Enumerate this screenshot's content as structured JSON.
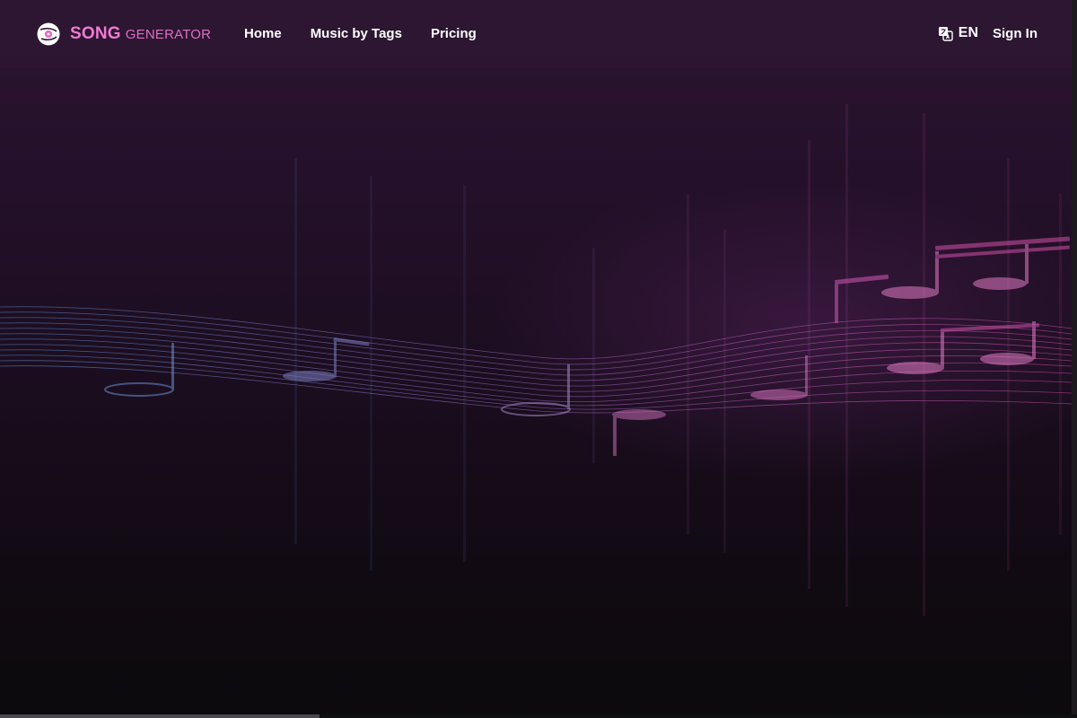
{
  "brand": {
    "name_primary": "SONG",
    "name_secondary": "GENERATOR",
    "logo_icon": "vinyl-disc-icon",
    "primary_color": "#f07ad2"
  },
  "nav": {
    "items": [
      {
        "label": "Home"
      },
      {
        "label": "Music by Tags"
      },
      {
        "label": "Pricing"
      }
    ]
  },
  "header_right": {
    "language_icon": "translate-icon",
    "language_label": "EN",
    "signin_label": "Sign In"
  },
  "colors": {
    "header_bg": "#2c1630",
    "page_bg_top": "#2c1530",
    "page_bg_bottom": "#0b0a0c",
    "wave_blue": "#5a8fd0",
    "wave_pink": "#d24fa8"
  },
  "hero": {
    "illustration": "music-staff-wave-with-notes"
  }
}
